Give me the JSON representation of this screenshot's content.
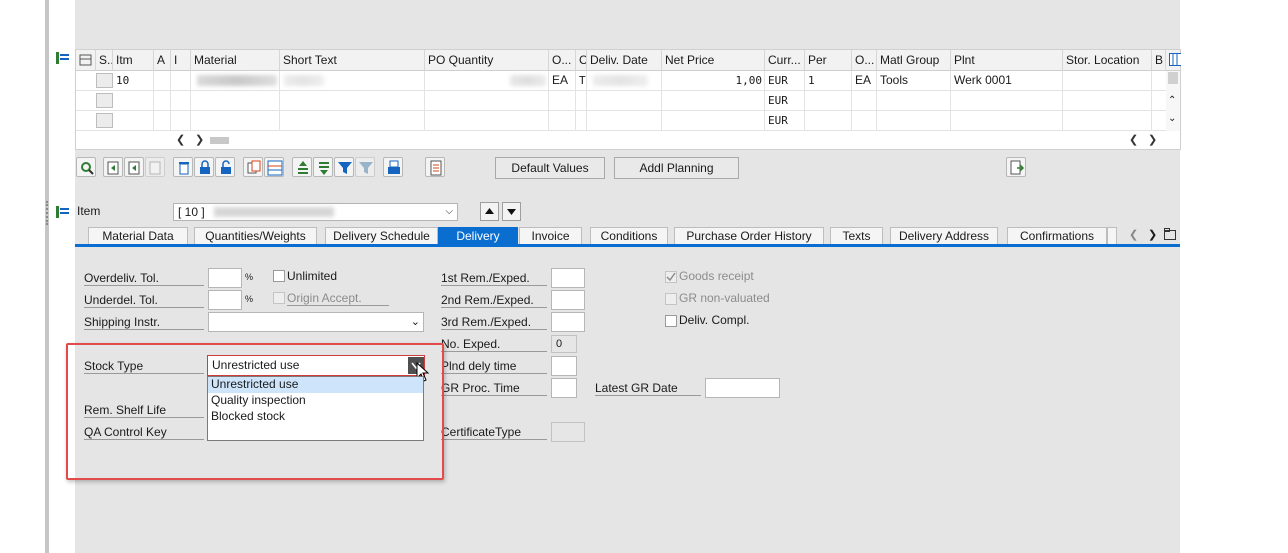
{
  "grid": {
    "headers": [
      "S..",
      "Itm",
      "A",
      "I",
      "Material",
      "Short Text",
      "PO Quantity",
      "O...",
      "C",
      "Deliv. Date",
      "Net Price",
      "Curr...",
      "Per",
      "O...",
      "Matl Group",
      "Plnt",
      "Stor. Location",
      "B"
    ],
    "row1": {
      "item": "10",
      "uom": "EA",
      "c": "T",
      "net_price": "1,00",
      "currency": "EUR",
      "per": "1",
      "order_unit": "EA",
      "matl_group": "Tools",
      "plant": "Werk 0001"
    },
    "row2": {
      "currency": "EUR"
    },
    "row3": {
      "currency": "EUR"
    }
  },
  "toolbar": {
    "default_values_label": "Default Values",
    "addl_planning_label": "Addl Planning"
  },
  "item": {
    "label": "Item",
    "selected": "[ 10 ]"
  },
  "tabs": [
    "Material Data",
    "Quantities/Weights",
    "Delivery Schedule",
    "Delivery",
    "Invoice",
    "Conditions",
    "Purchase Order History",
    "Texts",
    "Delivery Address",
    "Confirmations"
  ],
  "active_tab": "Delivery",
  "form": {
    "overdeliv_label": "Overdeliv. Tol.",
    "underdel_label": "Underdel. Tol.",
    "percent": "%",
    "unlimited_label": "Unlimited",
    "origin_accept_label": "Origin Accept.",
    "shipping_instr_label": "Shipping Instr.",
    "stock_type_label": "Stock Type",
    "stock_type_value": "Unrestricted use",
    "rem_shelf_life_label": "Rem. Shelf Life",
    "qa_control_key_label": "QA Control Key",
    "rem1_label": "1st Rem./Exped.",
    "rem2_label": "2nd Rem./Exped.",
    "rem3_label": "3rd Rem./Exped.",
    "no_exped_label": "No. Exped.",
    "no_exped_value": "0",
    "plnd_dely_label": "Plnd dely time",
    "gr_proc_label": "GR Proc. Time",
    "latest_gr_label": "Latest GR Date",
    "cert_type_label": "CertificateType",
    "goods_receipt_label": "Goods receipt",
    "gr_nonvalued_label": "GR non-valuated",
    "deliv_compl_label": "Deliv. Compl."
  },
  "dropdown": {
    "options": [
      "Unrestricted use",
      "Quality inspection",
      "Blocked stock"
    ],
    "selected_index": 0
  },
  "colors": {
    "accent": "#0a6ed1",
    "highlight_border": "#e24b4b",
    "selection": "#cde4fb"
  }
}
